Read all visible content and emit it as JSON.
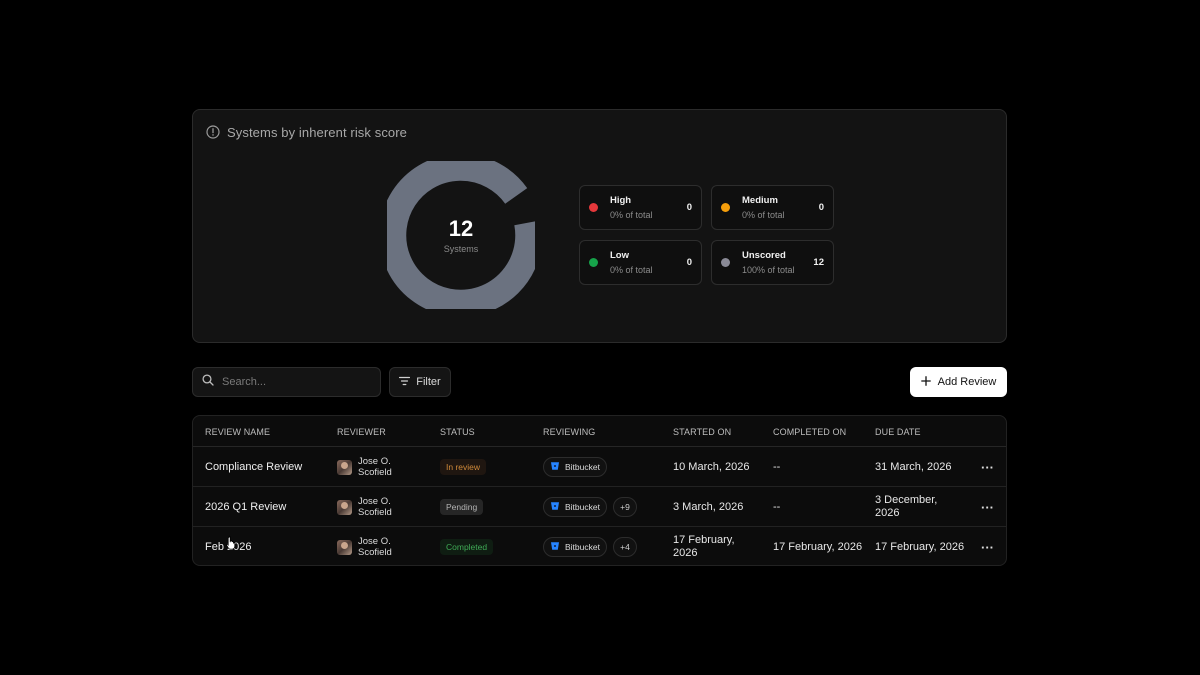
{
  "risk_card": {
    "title": "Systems by inherent risk score",
    "icon": "alert-circle-icon",
    "donut": {
      "total": "12",
      "caption": "Systems",
      "ring_color": "#6b7280"
    },
    "legend": [
      {
        "name": "High",
        "pct": "0% of total",
        "count": "0",
        "color": "#e5383b"
      },
      {
        "name": "Medium",
        "pct": "0% of total",
        "count": "0",
        "color": "#f59e0b"
      },
      {
        "name": "Low",
        "pct": "0% of total",
        "count": "0",
        "color": "#16a34a"
      },
      {
        "name": "Unscored",
        "pct": "100% of total",
        "count": "12",
        "color": "#8a8a96"
      }
    ]
  },
  "toolbar": {
    "search_placeholder": "Search...",
    "filter_label": "Filter",
    "add_label": "Add Review"
  },
  "table": {
    "headers": [
      "REVIEW NAME",
      "REVIEWER",
      "STATUS",
      "REVIEWING",
      "STARTED ON",
      "COMPLETED ON",
      "DUE DATE"
    ],
    "rows": [
      {
        "name": "Compliance Review",
        "reviewer": "Jose O. Scofield",
        "status": "In review",
        "reviewing": "Bitbucket",
        "more": "",
        "started": "10 March, 2026",
        "completed": "--",
        "due": "31 March, 2026"
      },
      {
        "name": "2026 Q1 Review",
        "reviewer": "Jose O. Scofield",
        "status": "Pending",
        "reviewing": "Bitbucket",
        "more": "+9",
        "started": "3 March, 2026",
        "completed": "--",
        "due": "3 December, 2026"
      },
      {
        "name": "Feb 2026",
        "reviewer": "Jose O. Scofield",
        "status": "Completed",
        "reviewing": "Bitbucket",
        "more": "+4",
        "started": "17 February, 2026",
        "completed": "17 February, 2026",
        "due": "17 February, 2026"
      }
    ],
    "row_action_glyph": "···"
  },
  "colors": {
    "bitbucket_blue": "#2684ff",
    "status_in_review": "#d08a3a",
    "status_pending": "#b5b5b5",
    "status_completed": "#3faa55"
  }
}
